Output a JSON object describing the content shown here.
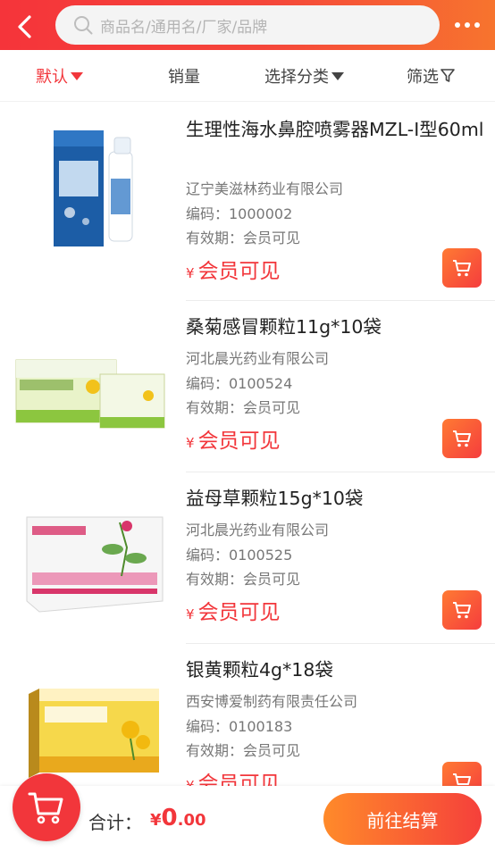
{
  "search": {
    "placeholder": "商品名/通用名/厂家/品牌"
  },
  "filters": [
    {
      "label": "默认",
      "active": true
    },
    {
      "label": "销量"
    },
    {
      "label": "选择分类"
    },
    {
      "label": "筛选"
    }
  ],
  "products": [
    {
      "name": "生理性海水鼻腔喷雾器MZL-I型60ml",
      "maker": "辽宁美滋林药业有限公司",
      "code": "编码：1000002",
      "expiry": "有效期：会员可见",
      "price_symbol": "¥",
      "price_text": "会员可见"
    },
    {
      "name": "桑菊感冒颗粒11g*10袋",
      "maker": "河北晨光药业有限公司",
      "code": "编码：0100524",
      "expiry": "有效期：会员可见",
      "price_symbol": "¥",
      "price_text": "会员可见"
    },
    {
      "name": "益母草颗粒15g*10袋",
      "maker": "河北晨光药业有限公司",
      "code": "编码：0100525",
      "expiry": "有效期：会员可见",
      "price_symbol": "¥",
      "price_text": "会员可见"
    },
    {
      "name": "银黄颗粒4g*18袋",
      "maker": "西安博爱制药有限责任公司",
      "code": "编码：0100183",
      "expiry": "有效期：会员可见",
      "price_symbol": "¥",
      "price_text": "会员可见"
    }
  ],
  "bottom": {
    "total_label": "合计：",
    "currency": "¥",
    "amount_int": "0",
    "amount_dec": ".00",
    "checkout_label": "前往结算"
  },
  "colors": {
    "accent": "#f2363b",
    "accent_orange": "#ff8a2a"
  }
}
